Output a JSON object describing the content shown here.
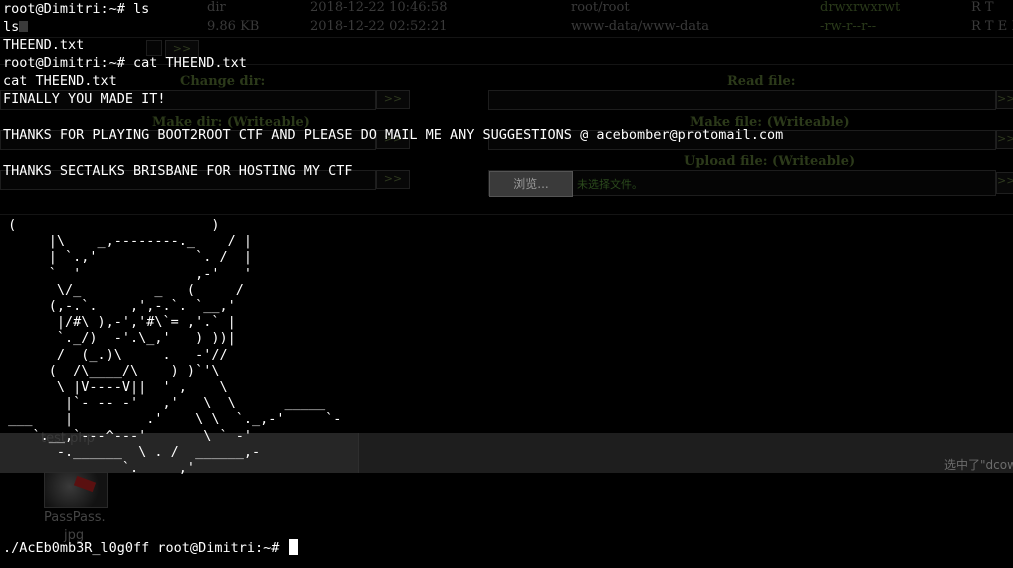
{
  "background_webshell": {
    "file_rows": [
      {
        "name": "",
        "size": "dir",
        "modified": "2018-12-22 10:46:58",
        "owner": "root/root",
        "perms": "drwxrwxrwt",
        "actions": "R T"
      },
      {
        "name": "",
        "size": "9.86 KB",
        "modified": "2018-12-22 02:52:21",
        "owner": "www-data/www-data",
        "perms": "-rw-r--r--",
        "actions": "R T E I"
      }
    ],
    "nav_button": ">>",
    "change_dir_label": "Change dir:",
    "read_file_label": "Read file:",
    "make_dir_label": "Make dir: (Writeable)",
    "make_file_label": "Make file: (Writeable)",
    "upload_file_label": "Upload file: (Writeable)",
    "browse_button": "浏览...",
    "no_file_selected": "未选择文件。",
    "go_button": ">>"
  },
  "desktop": {
    "file_label": "test.php",
    "icon_label_1": "PassPass.",
    "icon_label_2": "jpg",
    "selection_message": "选中了\"dcow"
  },
  "terminal": {
    "lines": [
      "root@Dimitri:~# ls",
      "ls",
      "THEEND.txt",
      "root@Dimitri:~# cat THEEND.txt",
      "cat THEEND.txt",
      "FINALLY YOU MADE IT!",
      "",
      "THANKS FOR PLAYING BOOT2ROOT CTF AND PLEASE DO MAIL ME ANY SUGGESTIONS @ acebomber@protomail.com",
      "",
      "THANKS SECTALKS BRISBANE FOR HOSTING MY CTF"
    ],
    "ascii_art": " (                        )\n      |\\    _,--------._    / |\n      | `.,'            `. /  |\n      `  '              ,-'   '\n       \\/_         _   (     /\n      (,-.`.    ,',-.`. `__,'\n       |/#\\ ),-','#\\`= ,'.` |\n       `._/)  -'.\\_,'   ) ))|\n       /  (_.)\\     .   -'//\n      (  /\\____/\\    ) )`'\\\n       \\ |V----V||  ' ,    \\\n        |`- -- -'   ,'   \\  \\      _____\n ___    |         .'    \\ \\  `._,-'     `-\n    `.__,`---^---'       \\ ` -'\n       -.______  \\ . /  ______,-\n               `.     ,'",
    "final_prompt": "./AcEb0mb3R_l0g0ff root@Dimitri:~# "
  }
}
